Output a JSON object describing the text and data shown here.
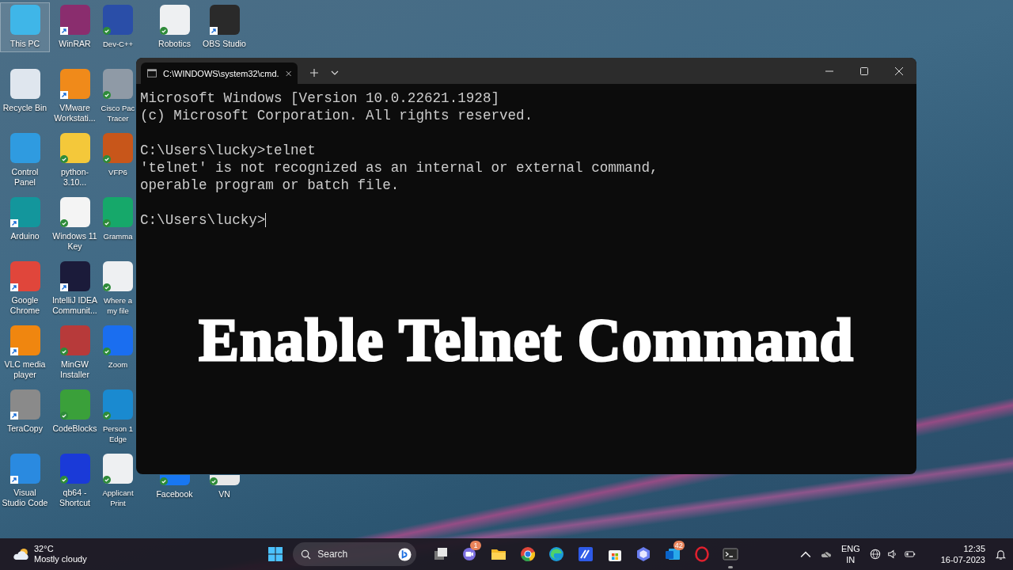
{
  "desktop_columns": [
    {
      "items": [
        {
          "label": "This PC",
          "color": "#3fb6e8",
          "shortcut": false,
          "synced": false,
          "selected": true
        },
        {
          "label": "Recycle Bin",
          "color": "#dfe6ee",
          "shortcut": false,
          "synced": false,
          "selected": false
        },
        {
          "label": "Control Panel",
          "color": "#2f9be0",
          "shortcut": false,
          "synced": false,
          "selected": false
        },
        {
          "label": "Arduino",
          "color": "#13969c",
          "shortcut": true,
          "synced": false,
          "selected": false
        },
        {
          "label": "Google Chrome",
          "color": "#e0463b",
          "shortcut": true,
          "synced": false,
          "selected": false
        },
        {
          "label": "VLC media player",
          "color": "#f0860f",
          "shortcut": true,
          "synced": false,
          "selected": false
        },
        {
          "label": "TeraCopy",
          "color": "#8a8a8a",
          "shortcut": true,
          "synced": false,
          "selected": false
        },
        {
          "label": "Visual Studio Code",
          "color": "#2a8ae0",
          "shortcut": true,
          "synced": false,
          "selected": false
        }
      ]
    },
    {
      "items": [
        {
          "label": "WinRAR",
          "color": "#8a2d6e",
          "shortcut": true,
          "synced": false,
          "selected": false
        },
        {
          "label": "VMware Workstati...",
          "color": "#f08a1a",
          "shortcut": true,
          "synced": false,
          "selected": false
        },
        {
          "label": "python-3.10...",
          "color": "#f4c83a",
          "shortcut": false,
          "synced": true,
          "selected": false
        },
        {
          "label": "Windows 11 Key",
          "color": "#f4f4f4",
          "shortcut": false,
          "synced": true,
          "selected": false
        },
        {
          "label": "IntelliJ IDEA Communit...",
          "color": "#1b1b3a",
          "shortcut": true,
          "synced": false,
          "selected": false
        },
        {
          "label": "MinGW Installer",
          "color": "#b73a3a",
          "shortcut": false,
          "synced": true,
          "selected": false
        },
        {
          "label": "CodeBlocks",
          "color": "#3aa03a",
          "shortcut": false,
          "synced": true,
          "selected": false
        },
        {
          "label": "qb64 - Shortcut",
          "color": "#1a3ad8",
          "shortcut": false,
          "synced": true,
          "selected": false
        }
      ]
    },
    {
      "items": [
        {
          "label": "Dev-C++",
          "color": "#2a4ea8",
          "shortcut": false,
          "synced": true,
          "selected": false
        },
        {
          "label": "Cisco Pac Tracer",
          "color": "#8f9aa6",
          "shortcut": false,
          "synced": true,
          "selected": false
        },
        {
          "label": "VFP6",
          "color": "#c8561a",
          "shortcut": false,
          "synced": true,
          "selected": false
        },
        {
          "label": "Gramma",
          "color": "#16a86a",
          "shortcut": false,
          "synced": true,
          "selected": false
        },
        {
          "label": "Where a my file",
          "color": "#eef0f2",
          "shortcut": false,
          "synced": true,
          "selected": false
        },
        {
          "label": "Zoom",
          "color": "#1a6ef0",
          "shortcut": false,
          "synced": true,
          "selected": false
        },
        {
          "label": "Person 1 Edge",
          "color": "#1a8ad0",
          "shortcut": false,
          "synced": true,
          "selected": false
        },
        {
          "label": "Applicant Print",
          "color": "#eef0f2",
          "shortcut": false,
          "synced": true,
          "selected": false
        }
      ]
    },
    {
      "items": [
        {
          "label": "Robotics",
          "color": "#eef0f2",
          "shortcut": false,
          "synced": true,
          "selected": false
        },
        {
          "label": "Facebook",
          "color": "#1877f2",
          "shortcut": false,
          "synced": true,
          "selected": false
        }
      ]
    },
    {
      "items": [
        {
          "label": "OBS Studio",
          "color": "#2a2a2a",
          "shortcut": true,
          "synced": false,
          "selected": false
        },
        {
          "label": "VN",
          "color": "#e8e8e8",
          "shortcut": false,
          "synced": true,
          "selected": false
        }
      ]
    }
  ],
  "terminal": {
    "tab": {
      "title": "C:\\WINDOWS\\system32\\cmd."
    },
    "blocks": [
      [
        "Microsoft Windows [Version 10.0.22621.1928]",
        "(c) Microsoft Corporation. All rights reserved."
      ],
      [
        "C:\\Users\\lucky>telnet",
        "'telnet' is not recognized as an internal or external command,",
        "operable program or batch file."
      ],
      [
        "C:\\Users\\lucky>"
      ]
    ]
  },
  "overlay_title": "Enable Telnet Command",
  "taskbar": {
    "weather": {
      "temperature": "32°C",
      "condition": "Mostly cloudy"
    },
    "search": {
      "label": "Search"
    },
    "apps": [
      {
        "kind": "taskview",
        "active": false
      },
      {
        "kind": "chat",
        "badge": "1",
        "active": false
      },
      {
        "kind": "explorer",
        "active": false
      },
      {
        "kind": "chrome",
        "active": false
      },
      {
        "kind": "edge",
        "active": false
      },
      {
        "kind": "editor",
        "active": false
      },
      {
        "kind": "store",
        "active": false
      },
      {
        "kind": "copilot",
        "active": false
      },
      {
        "kind": "mail",
        "badge": "42",
        "active": false
      },
      {
        "kind": "opera",
        "active": false
      },
      {
        "kind": "terminal",
        "active": true
      }
    ],
    "language": {
      "line1": "ENG",
      "line2": "IN"
    },
    "clock": {
      "time": "12:35",
      "date": "16-07-2023"
    }
  }
}
